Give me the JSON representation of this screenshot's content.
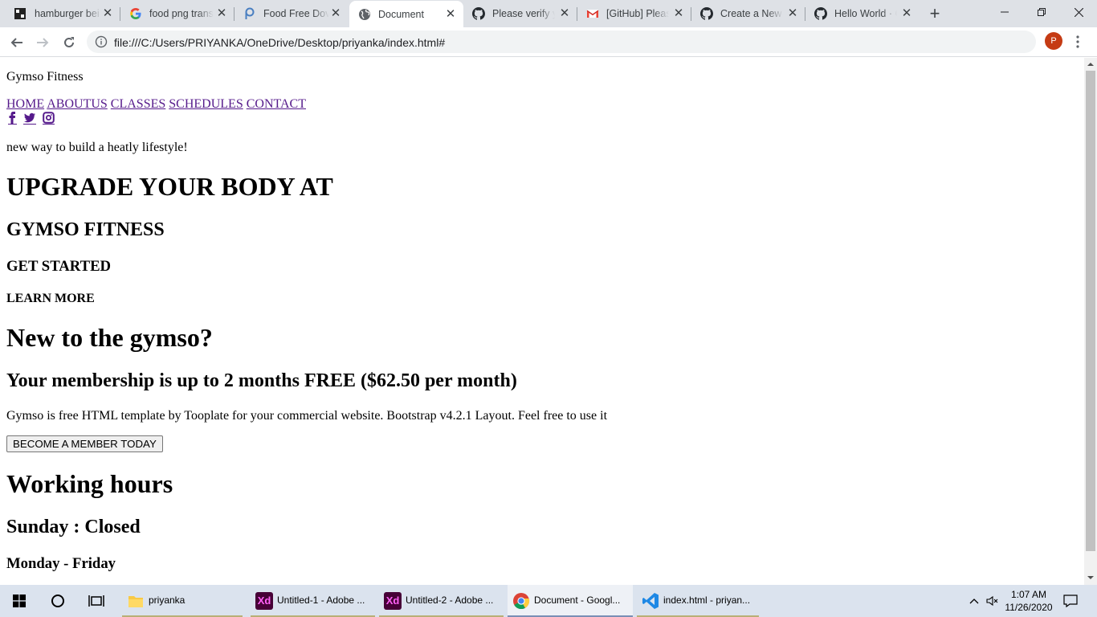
{
  "browser": {
    "tabs": [
      {
        "title": "hamburger bei",
        "icon": "hamburger-favicon-icon",
        "active": false
      },
      {
        "title": "food png trans",
        "icon": "google-icon",
        "active": false
      },
      {
        "title": "Food Free Dov",
        "icon": "picsart-icon",
        "active": false
      },
      {
        "title": "Document",
        "icon": "globe-icon",
        "active": true
      },
      {
        "title": "Please verify yo",
        "icon": "github-icon",
        "active": false
      },
      {
        "title": "[GitHub] Please",
        "icon": "gmail-icon",
        "active": false
      },
      {
        "title": "Create a New R",
        "icon": "github-icon",
        "active": false
      },
      {
        "title": "Hello World · G",
        "icon": "github-icon",
        "active": false
      }
    ],
    "address": "file:///C:/Users/PRIYANKA/OneDrive/Desktop/priyanka/index.html#",
    "profile_initial": "P",
    "accent": "#c53b14"
  },
  "page": {
    "brand": "Gymso Fitness",
    "nav": [
      "HOME",
      "ABOUTUS",
      "CLASSES",
      "SCHEDULES",
      "CONTACT"
    ],
    "social_icons": [
      "facebook-icon",
      "twitter-icon",
      "instagram-icon"
    ],
    "tagline": "new way to build a heatly lifestyle!",
    "hero_h1": "UPGRADE YOUR BODY AT",
    "hero_h2": "GYMSO FITNESS",
    "cta_primary": "GET STARTED",
    "cta_secondary": "LEARN MORE",
    "about_h1": "New to the gymso?",
    "about_h2": "Your membership is up to 2 months FREE ($62.50 per month)",
    "about_text": "Gymso is free HTML template by Tooplate for your commercial website. Bootstrap v4.2.1 Layout. Feel free to use it",
    "member_button": "BECOME A MEMBER TODAY",
    "hours_title": "Working hours",
    "hours_sunday": "Sunday : Closed",
    "hours_weekday": "Monday - Friday"
  },
  "taskbar": {
    "apps": [
      {
        "label": "priyanka",
        "icon": "folder-icon"
      },
      {
        "label": "Untitled-1 - Adobe ...",
        "icon": "adobe-xd-icon",
        "badge": "Xd"
      },
      {
        "label": "Untitled-2 - Adobe ...",
        "icon": "adobe-xd-icon",
        "badge": "Xd"
      },
      {
        "label": "Document - Googl...",
        "icon": "chrome-icon"
      },
      {
        "label": "index.html - priyan...",
        "icon": "vscode-icon"
      }
    ],
    "time": "1:07 AM",
    "date": "11/26/2020"
  }
}
